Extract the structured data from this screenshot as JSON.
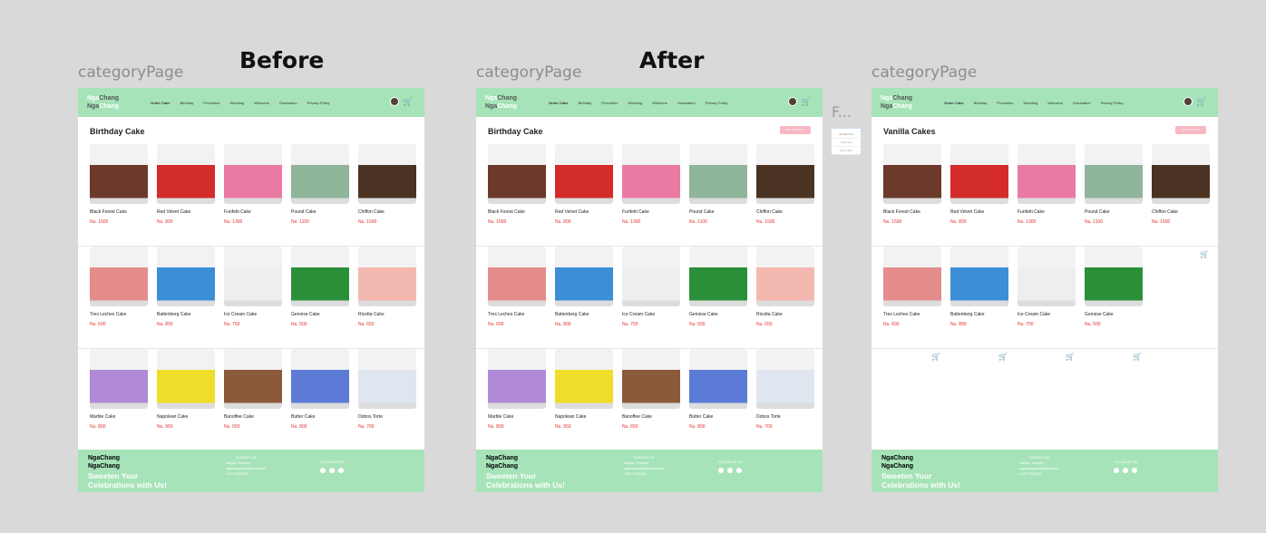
{
  "headings": {
    "before": "Before",
    "after": "After"
  },
  "board_label": "categoryPage",
  "frame_suffix": "F...",
  "header": {
    "logo_top_a": "Nga",
    "logo_top_b": "Chang",
    "logo_bot_a": "Nga",
    "logo_bot_b": "Chang",
    "nav": [
      "Order Cake",
      "Birthday",
      "Promotion",
      "Wedding",
      "Welcome",
      "Graduation",
      "Privacy Policy"
    ]
  },
  "sort_label": "Sort By Name ▾",
  "popup_items": [
    "Alphabetical",
    "Price low",
    "Price high"
  ],
  "titles": {
    "birthday": "Birthday Cake",
    "vanilla": "Vanilla Cakes"
  },
  "cakes": [
    {
      "name": "Black Forest Cake",
      "price": "Nu. 1500",
      "color": "#6b3a2a"
    },
    {
      "name": "Red Velvet Cake",
      "price": "Nu. 800",
      "color": "#d42b2b"
    },
    {
      "name": "Funfetti Cake",
      "price": "Nu. 1300",
      "color": "#e97aa4"
    },
    {
      "name": "Pound Cake",
      "price": "Nu. 1100",
      "color": "#8fb59b"
    },
    {
      "name": "Chiffon Cake",
      "price": "Nu. 1500",
      "color": "#4a3322"
    },
    {
      "name": "Tres Leches Cake",
      "price": "Nu. 600",
      "color": "#e58c8c"
    },
    {
      "name": "Battenberg Cake",
      "price": "Nu. 800",
      "color": "#3c8fd6"
    },
    {
      "name": "Ice Cream Cake",
      "price": "Nu. 750",
      "color": "#eeeeee"
    },
    {
      "name": "Genoise Cake",
      "price": "Nu. 500",
      "color": "#2b8f3a"
    },
    {
      "name": "Ricotta Cake",
      "price": "Nu. 650",
      "color": "#f3b9b0"
    },
    {
      "name": "Marble Cake",
      "price": "Nu. 800",
      "color": "#b08ad6"
    },
    {
      "name": "Napolean Cake",
      "price": "Nu. 950",
      "color": "#eedd2a"
    },
    {
      "name": "Banoffee Cake",
      "price": "Nu. 650",
      "color": "#8a5a3a"
    },
    {
      "name": "Butter Cake",
      "price": "Nu. 800",
      "color": "#5b7bd6"
    },
    {
      "name": "Dobos Torte",
      "price": "Nu. 700",
      "color": "#e0e6f0"
    }
  ],
  "footer": {
    "tagline_1": "Sweeten Your",
    "tagline_2": "Celebrations with Us!",
    "contact_title": "CONTACT US",
    "contact_lines": [
      "Kabjisa, Thimphu",
      "ngachangcakes@gmail.com",
      "+975 77320432"
    ],
    "follow_title": "FOLLOW US ON"
  }
}
